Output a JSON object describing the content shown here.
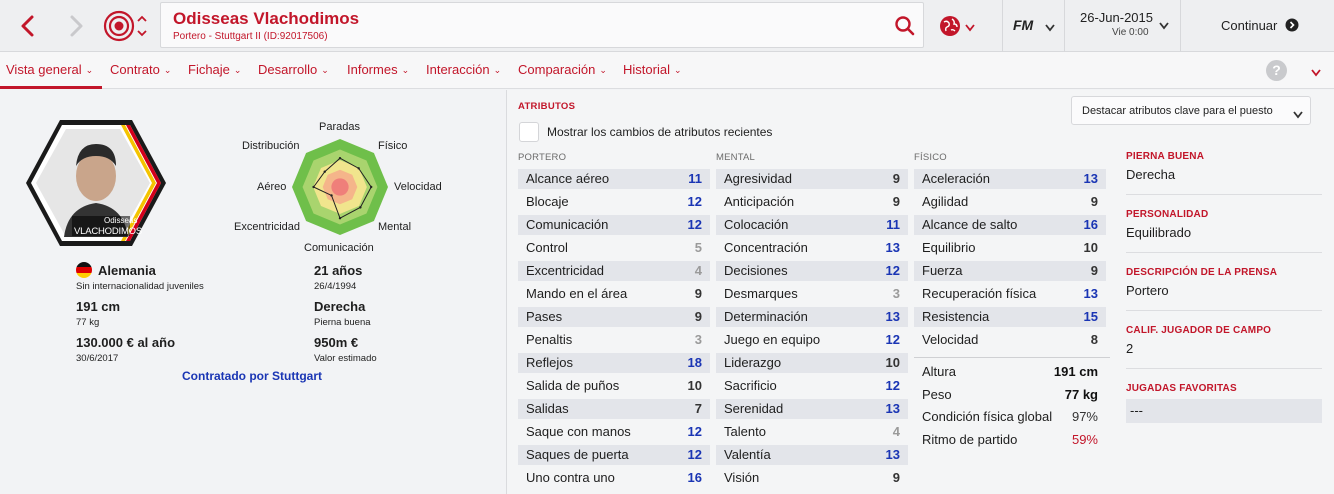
{
  "top": {
    "player_name": "Odisseas Vlachodimos",
    "player_sub": "Portero - Stuttgart II (ID:92017506)",
    "fm_label": "FM",
    "date": "26-Jun-2015",
    "day_time": "Vie 0:00",
    "continue_label": "Continuar"
  },
  "menu": [
    {
      "label": "Vista general"
    },
    {
      "label": "Contrato"
    },
    {
      "label": "Fichaje"
    },
    {
      "label": "Desarrollo"
    },
    {
      "label": "Informes"
    },
    {
      "label": "Interacción"
    },
    {
      "label": "Comparación"
    },
    {
      "label": "Historial"
    }
  ],
  "profile": {
    "card_first": "Odisseas",
    "card_last": "VLACHODIMOS",
    "nation": "Alemania",
    "intl": "Sin internacionalidad juveniles",
    "height": "191 cm",
    "weight": "77 kg",
    "wage": "130.000 € al año",
    "contract_end": "30/6/2017",
    "age": "21 años",
    "dob": "26/4/1994",
    "foot": "Derecha",
    "foot_label": "Pierna buena",
    "value": "950m €",
    "value_label": "Valor estimado",
    "contract_by": "Contratado por Stuttgart"
  },
  "radar": {
    "labels": [
      "Paradas",
      "Físico",
      "Velocidad",
      "Mental",
      "Comunicación",
      "Excentricidad",
      "Aéreo",
      "Distribución"
    ],
    "values": [
      12,
      11,
      13,
      12,
      13,
      5,
      11,
      9
    ]
  },
  "attrs": {
    "title": "ATRIBUTOS",
    "highlight_select": "Destacar atributos clave para el puesto",
    "recent_changes": "Mostrar los cambios de atributos recientes",
    "portero_title": "PORTERO",
    "mental_title": "MENTAL",
    "fisico_title": "FÍSICO",
    "portero": [
      {
        "n": "Alcance aéreo",
        "v": "11"
      },
      {
        "n": "Blocaje",
        "v": "12"
      },
      {
        "n": "Comunicación",
        "v": "12"
      },
      {
        "n": "Control",
        "v": "5"
      },
      {
        "n": "Excentricidad",
        "v": "4"
      },
      {
        "n": "Mando en el área",
        "v": "9"
      },
      {
        "n": "Pases",
        "v": "9"
      },
      {
        "n": "Penaltis",
        "v": "3"
      },
      {
        "n": "Reflejos",
        "v": "18"
      },
      {
        "n": "Salida de puños",
        "v": "10"
      },
      {
        "n": "Salidas",
        "v": "7"
      },
      {
        "n": "Saque con manos",
        "v": "12"
      },
      {
        "n": "Saques de puerta",
        "v": "12"
      },
      {
        "n": "Uno contra uno",
        "v": "16"
      }
    ],
    "mental": [
      {
        "n": "Agresividad",
        "v": "9"
      },
      {
        "n": "Anticipación",
        "v": "9"
      },
      {
        "n": "Colocación",
        "v": "11"
      },
      {
        "n": "Concentración",
        "v": "13"
      },
      {
        "n": "Decisiones",
        "v": "12"
      },
      {
        "n": "Desmarques",
        "v": "3"
      },
      {
        "n": "Determinación",
        "v": "13"
      },
      {
        "n": "Juego en equipo",
        "v": "12"
      },
      {
        "n": "Liderazgo",
        "v": "10"
      },
      {
        "n": "Sacrificio",
        "v": "12"
      },
      {
        "n": "Serenidad",
        "v": "13"
      },
      {
        "n": "Talento",
        "v": "4"
      },
      {
        "n": "Valentía",
        "v": "13"
      },
      {
        "n": "Visión",
        "v": "9"
      }
    ],
    "fisico": [
      {
        "n": "Aceleración",
        "v": "13"
      },
      {
        "n": "Agilidad",
        "v": "9"
      },
      {
        "n": "Alcance de salto",
        "v": "16"
      },
      {
        "n": "Equilibrio",
        "v": "10"
      },
      {
        "n": "Fuerza",
        "v": "9"
      },
      {
        "n": "Recuperación física",
        "v": "13"
      },
      {
        "n": "Resistencia",
        "v": "15"
      },
      {
        "n": "Velocidad",
        "v": "8"
      }
    ],
    "extra": [
      {
        "n": "Altura",
        "v": "191 cm"
      },
      {
        "n": "Peso",
        "v": "77 kg"
      },
      {
        "n": "Condición física global",
        "v": "97%"
      },
      {
        "n": "Ritmo de partido",
        "v": "59%"
      }
    ]
  },
  "side": {
    "foot_t": "PIERNA BUENA",
    "foot_v": "Derecha",
    "pers_t": "PERSONALIDAD",
    "pers_v": "Equilibrado",
    "press_t": "DESCRIPCIÓN DE LA PRENSA",
    "press_v": "Portero",
    "calif_t": "CALIF. JUGADOR DE CAMPO",
    "calif_v": "2",
    "plays_t": "JUGADAS FAVORITAS",
    "plays_v": "---"
  },
  "colors": {
    "accent": "#c2162a",
    "hi": "#1a35b4"
  }
}
